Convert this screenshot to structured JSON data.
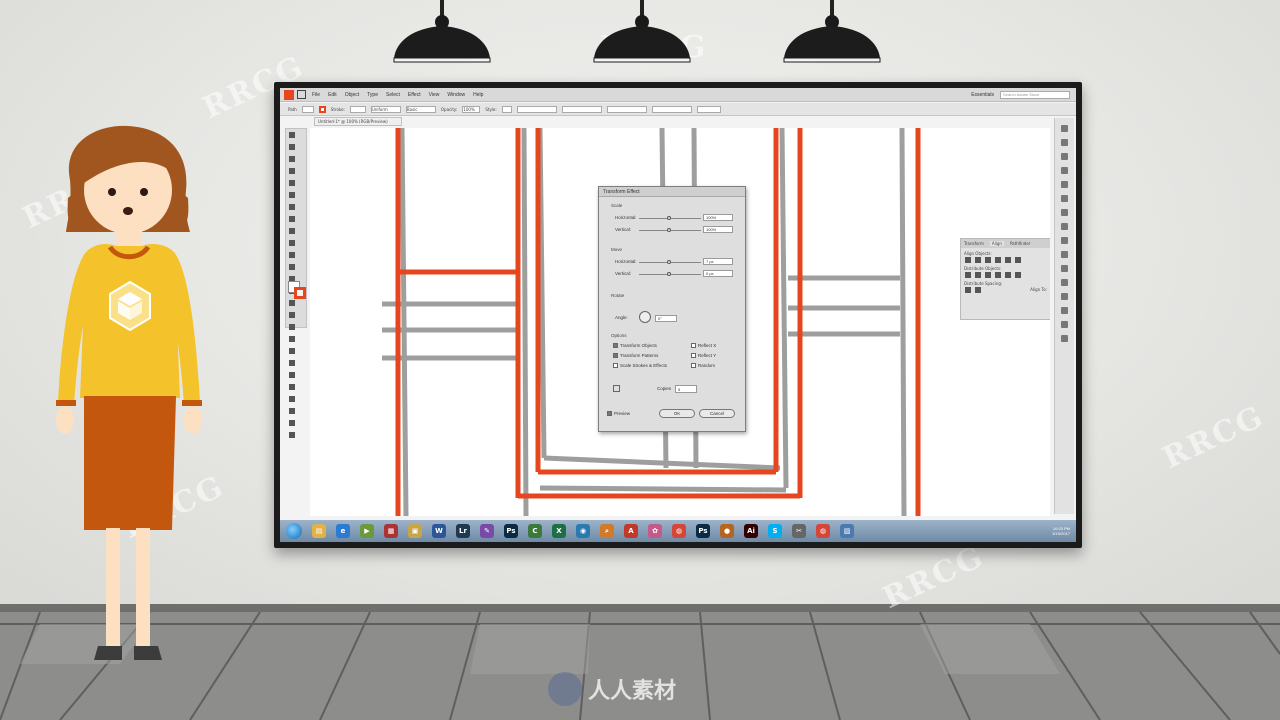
{
  "watermark": "RRCG",
  "watermark_cn": "人人素材",
  "menubar": {
    "items": [
      "File",
      "Edit",
      "Object",
      "Type",
      "Select",
      "Effect",
      "View",
      "Window",
      "Help"
    ],
    "workspace": "Essentials",
    "search_placeholder": "Search Adobe Stock"
  },
  "ctrlbar": {
    "mode": "Path",
    "stroke_label": "Stroke:",
    "uniform": "Uniform",
    "basic": "Basic",
    "opacity_label": "Opacity:",
    "opacity": "100%",
    "style_label": "Style:"
  },
  "doc_tab": "Untitled-1* @ 100% (RGB/Preview)",
  "align_panel": {
    "tabs": [
      "Transform",
      "Align",
      "Pathfinder"
    ],
    "align_objects": "Align Objects:",
    "distribute_objects": "Distribute Objects:",
    "distribute_spacing": "Distribute Spacing:",
    "align_to": "Align To:"
  },
  "dialog": {
    "title": "Transform Effect",
    "scale_label": "Scale",
    "horizontal_label": "Horizontal:",
    "vertical_label": "Vertical:",
    "scale_h": "100%",
    "scale_v": "100%",
    "move_label": "Move",
    "move_h": "7 px",
    "move_v": "0 px",
    "rotate_label": "Rotate",
    "angle_label": "Angle:",
    "angle": "0°",
    "options_label": "Options",
    "opt_transform_objects": "Transform Objects",
    "opt_transform_patterns": "Transform Patterns",
    "opt_scale_strokes": "Scale Strokes & Effects",
    "opt_reflect_x": "Reflect X",
    "opt_reflect_y": "Reflect Y",
    "opt_random": "Random",
    "copies_label": "Copies",
    "copies": "5",
    "preview_label": "Preview",
    "ok_label": "OK",
    "cancel_label": "Cancel",
    "checked": {
      "transform_objects": true,
      "transform_patterns": true,
      "scale_strokes": false,
      "reflect_x": false,
      "reflect_y": false,
      "random": false,
      "preview": true
    }
  },
  "taskbar": {
    "apps": [
      {
        "name": "explorer",
        "glyph": "▤",
        "color": "#e0b34a"
      },
      {
        "name": "ie",
        "glyph": "e",
        "color": "#2c7bd3"
      },
      {
        "name": "media",
        "glyph": "▶",
        "color": "#6a9a3c"
      },
      {
        "name": "calc",
        "glyph": "▦",
        "color": "#a33"
      },
      {
        "name": "folder",
        "glyph": "▣",
        "color": "#c9a54a"
      },
      {
        "name": "word",
        "glyph": "W",
        "color": "#2b579a"
      },
      {
        "name": "lightroom",
        "glyph": "Lr",
        "color": "#1d3a4f"
      },
      {
        "name": "tool",
        "glyph": "✎",
        "color": "#7a4aa8"
      },
      {
        "name": "photoshop",
        "glyph": "Ps",
        "color": "#0b2b45"
      },
      {
        "name": "camtasia",
        "glyph": "C",
        "color": "#3b7a3b"
      },
      {
        "name": "excel",
        "glyph": "X",
        "color": "#1d7044"
      },
      {
        "name": "globe",
        "glyph": "◉",
        "color": "#2a7ab0"
      },
      {
        "name": "search",
        "glyph": "⌕",
        "color": "#d07a2a"
      },
      {
        "name": "acrobat",
        "glyph": "A",
        "color": "#c0392b"
      },
      {
        "name": "paint",
        "glyph": "✿",
        "color": "#c45a8a"
      },
      {
        "name": "chrome",
        "glyph": "◍",
        "color": "#d44638"
      },
      {
        "name": "photoshop2",
        "glyph": "Ps",
        "color": "#0b2b45"
      },
      {
        "name": "ball",
        "glyph": "●",
        "color": "#b5651d"
      },
      {
        "name": "illustrator",
        "glyph": "Ai",
        "color": "#330000"
      },
      {
        "name": "skype",
        "glyph": "S",
        "color": "#00aff0"
      },
      {
        "name": "tools",
        "glyph": "✂",
        "color": "#666"
      },
      {
        "name": "chrome2",
        "glyph": "◍",
        "color": "#d44638"
      },
      {
        "name": "photos",
        "glyph": "▧",
        "color": "#4a7ab0"
      }
    ],
    "time": "10:25 PM",
    "date": "3/15/2017"
  },
  "colors": {
    "accent": "#e5461d",
    "shirt": "#f4c22b",
    "skirt": "#c2570d",
    "hair": "#a0561e"
  }
}
